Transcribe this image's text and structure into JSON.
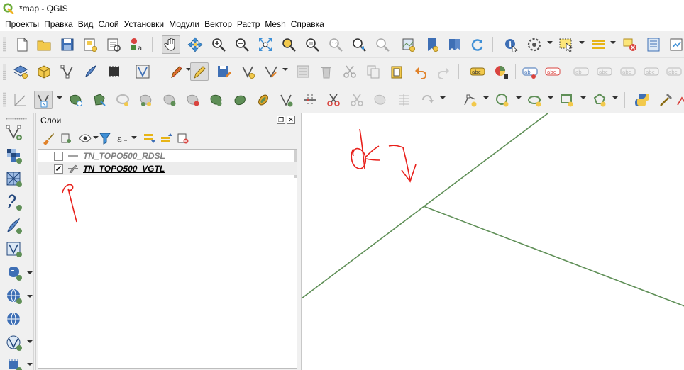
{
  "window": {
    "title": "*map - QGIS",
    "app_icon": "qgis-logo-icon"
  },
  "menu": [
    {
      "label": "Проекты",
      "underline_index": 0
    },
    {
      "label": "Правка",
      "underline_index": 0
    },
    {
      "label": "Вид",
      "underline_index": 0
    },
    {
      "label": "Слой",
      "underline_index": 0
    },
    {
      "label": "Установки",
      "underline_index": 0
    },
    {
      "label": "Модули",
      "underline_index": 0
    },
    {
      "label": "Вектор",
      "underline_index": 1
    },
    {
      "label": "Растр",
      "underline_index": 1
    },
    {
      "label": "Mesh",
      "underline_index": 0
    },
    {
      "label": "Справка",
      "underline_index": 0
    }
  ],
  "layers_panel": {
    "title": "Слои",
    "layers": [
      {
        "name": "TN_TOPO500_RDSL",
        "checked": false,
        "symbol_color": "#8a8a8a",
        "selected": false
      },
      {
        "name": "TN_TOPO500_VGTL",
        "checked": true,
        "symbol_color": "#5a5a5a",
        "selected": true
      }
    ]
  },
  "map": {
    "line_color": "#5f8f57",
    "background": "#ffffff"
  },
  "annotations": {
    "color": "#e8201b"
  }
}
